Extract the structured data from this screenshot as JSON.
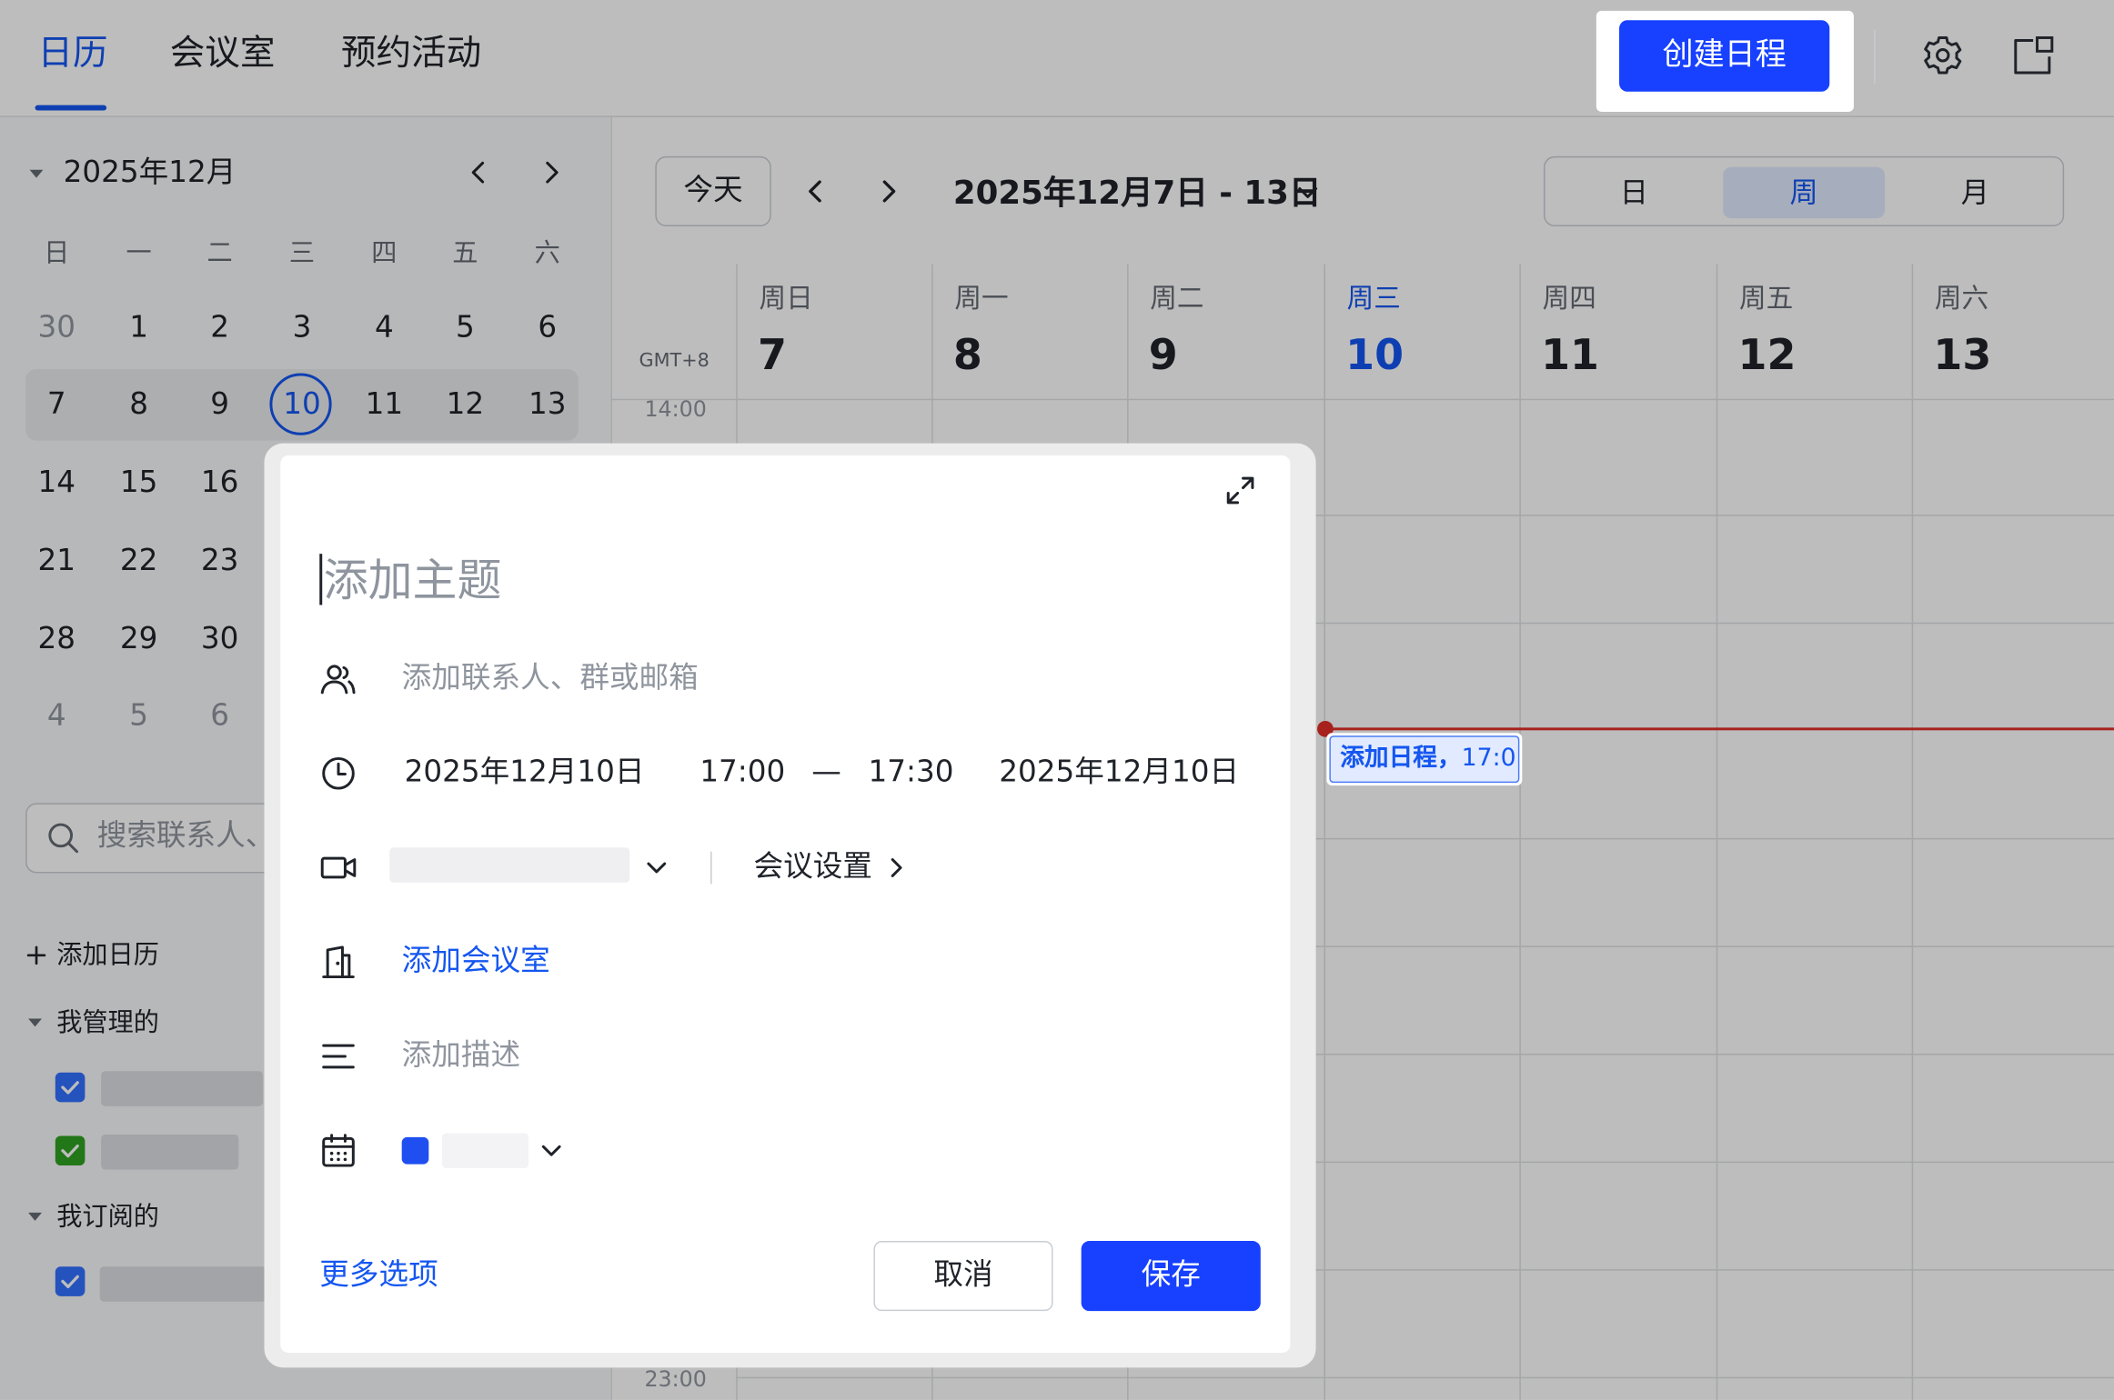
{
  "header": {
    "tabs": [
      {
        "label": "日历",
        "active": true
      },
      {
        "label": "会议室",
        "active": false
      },
      {
        "label": "预约活动",
        "active": false
      }
    ],
    "create_button": "创建日程",
    "accent_color": "#1456f0"
  },
  "mini_calendar": {
    "title": "2025年12月",
    "weekdays": [
      "日",
      "一",
      "二",
      "三",
      "四",
      "五",
      "六"
    ],
    "weeks": [
      [
        "30",
        "1",
        "2",
        "3",
        "4",
        "5",
        "6"
      ],
      [
        "7",
        "8",
        "9",
        "10",
        "11",
        "12",
        "13"
      ],
      [
        "14",
        "15",
        "16"
      ],
      [
        "21",
        "22",
        "23"
      ],
      [
        "28",
        "29",
        "30"
      ],
      [
        "4",
        "5",
        "6"
      ]
    ],
    "today": "10"
  },
  "sidebar": {
    "search_placeholder": "搜索联系人、",
    "add_calendar": "添加日历",
    "managed_section": "我管理的",
    "subscribed_section": "我订阅的",
    "checkbox_colors": [
      "#3370ff",
      "#2ea121",
      "#3370ff"
    ]
  },
  "toolbar": {
    "today_button": "今天",
    "date_range": "2025年12月7日 - 13日",
    "view_options": [
      "日",
      "周",
      "月"
    ],
    "active_view": "周"
  },
  "week_grid": {
    "timezone": "GMT+8",
    "days": [
      {
        "name": "周日",
        "num": "7"
      },
      {
        "name": "周一",
        "num": "8"
      },
      {
        "name": "周二",
        "num": "9"
      },
      {
        "name": "周三",
        "num": "10",
        "today": true
      },
      {
        "name": "周四",
        "num": "11"
      },
      {
        "name": "周五",
        "num": "12"
      },
      {
        "name": "周六",
        "num": "13"
      }
    ],
    "time_top": "14:00",
    "time_bottom": "23:00",
    "event_title": "添加日程，",
    "event_time": "17:0"
  },
  "dialog": {
    "title_placeholder": "添加主题",
    "attendees_placeholder": "添加联系人、群或邮箱",
    "start_date": "2025年12月10日",
    "start_time": "17:00",
    "dash": "—",
    "end_time": "17:30",
    "end_date": "2025年12月10日",
    "meeting_settings": "会议设置",
    "add_room": "添加会议室",
    "description_placeholder": "添加描述",
    "calendar_color": "#1f4ff0",
    "more_options": "更多选项",
    "cancel": "取消",
    "save": "保存"
  }
}
